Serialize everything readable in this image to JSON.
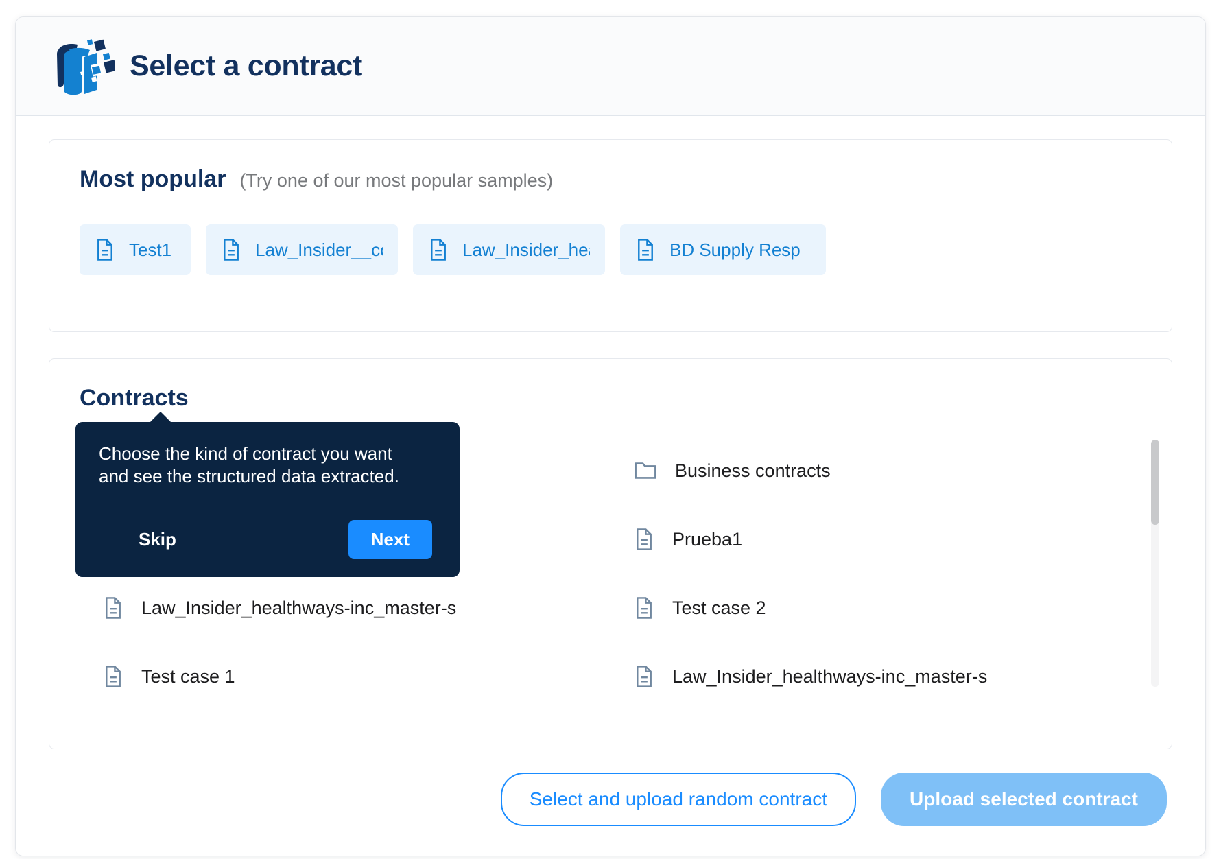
{
  "header": {
    "title": "Select a contract",
    "logo_icon": "database-cylinder-logo"
  },
  "popular": {
    "heading": "Most popular",
    "subheading": "(Try one of our most popular samples)",
    "chips": [
      {
        "label": "Test1",
        "icon": "document-icon"
      },
      {
        "label": "Law_Insider__co",
        "icon": "document-icon"
      },
      {
        "label": "Law_Insider_hea",
        "icon": "document-icon"
      },
      {
        "label": "BD Supply Resp",
        "icon": "document-icon"
      }
    ]
  },
  "contracts": {
    "heading": "Contracts",
    "items": [
      {
        "label": "Business contracts",
        "icon": "folder-icon",
        "type": "folder",
        "column": "right",
        "row": 1
      },
      {
        "label": "Prueba1",
        "icon": "document-icon",
        "type": "file",
        "column": "right",
        "row": 2
      },
      {
        "label": "Law_Insider_healthways-inc_master-s",
        "icon": "document-icon",
        "type": "file",
        "column": "left",
        "row": 3
      },
      {
        "label": "Test case 2",
        "icon": "document-icon",
        "type": "file",
        "column": "right",
        "row": 3
      },
      {
        "label": "Test case 1",
        "icon": "document-icon",
        "type": "file",
        "column": "left",
        "row": 4
      },
      {
        "label": "Law_Insider_healthways-inc_master-s",
        "icon": "document-icon",
        "type": "file",
        "column": "right",
        "row": 4
      }
    ],
    "scrollbar": {
      "name": "contracts-scrollbar"
    }
  },
  "coachmark": {
    "text": "Choose the kind of contract you want and see the structured data extracted.",
    "skip_label": "Skip",
    "next_label": "Next"
  },
  "footer": {
    "random_label": "Select and upload random contract",
    "upload_label": "Upload selected contract"
  },
  "colors": {
    "brand_navy": "#12315e",
    "accent_blue": "#1a8cff",
    "chip_bg": "#eaf4fd",
    "chip_text": "#1380d2",
    "coachmark_bg": "#0b2441",
    "primary_disabled": "#7fc0f7",
    "icon_slate": "#70879f"
  }
}
